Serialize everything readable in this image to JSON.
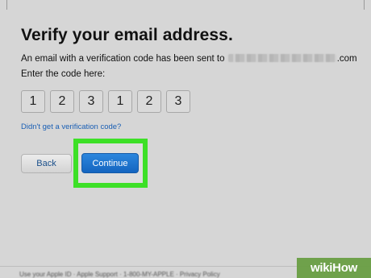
{
  "page": {
    "heading": "Verify your email address.",
    "sent_text": "An email with a verification code has been sent to",
    "email_suffix": ".com",
    "enter_code_text": "Enter the code here:",
    "code_digits": [
      "1",
      "2",
      "3",
      "1",
      "2",
      "3"
    ],
    "resend_link": "Didn't get a verification code?",
    "back_label": "Back",
    "continue_label": "Continue"
  },
  "footer": {
    "text": "Use your Apple ID · Apple Support · 1-800-MY-APPLE · Privacy Policy"
  },
  "watermark": {
    "text": "wikiHow"
  },
  "colors": {
    "background": "#d6d6d6",
    "highlight": "#3de027",
    "continue_button": "#1a6fd0",
    "link": "#1a5fb4"
  }
}
